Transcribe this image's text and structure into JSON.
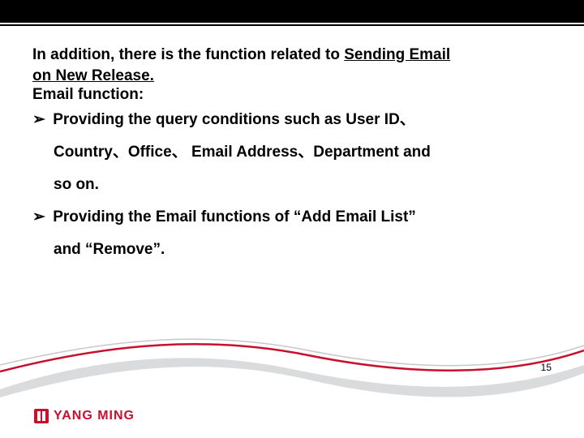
{
  "intro": {
    "prefix": "In addition, there is the function related to ",
    "underlined": "Sending Email on New Release.",
    "line1_underlined_part": "Sending Email",
    "line2_underlined_part": "on New Release."
  },
  "section_title": "Email function:",
  "bullets": [
    {
      "marker": "➢",
      "text_line1": "Providing the query conditions such as User ID、",
      "text_line2": "Country、Office、 Email Address、Department and",
      "text_line3": "so on."
    },
    {
      "marker": "➢",
      "text_line1": "Providing the Email functions of “Add Email List”",
      "text_line2": "and “Remove”."
    }
  ],
  "page_number": "15",
  "logo": {
    "text": "YANG MING"
  },
  "colors": {
    "brand_red": "#c8102e",
    "swoosh_gray": "#d9dbdd"
  }
}
